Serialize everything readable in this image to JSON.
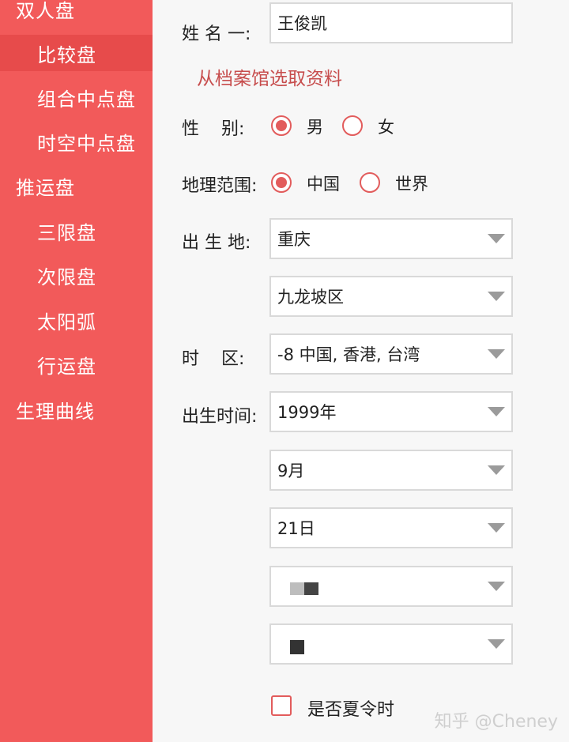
{
  "sidebar": {
    "items": [
      {
        "label": "双人盘"
      },
      {
        "label": "比较盘"
      },
      {
        "label": "组合中点盘"
      },
      {
        "label": "时空中点盘"
      },
      {
        "label": "推运盘"
      },
      {
        "label": "三限盘"
      },
      {
        "label": "次限盘"
      },
      {
        "label": "太阳弧"
      },
      {
        "label": "行运盘"
      },
      {
        "label": "生理曲线"
      }
    ]
  },
  "form": {
    "name_label": "姓 名 一:",
    "name_value": "王俊凯",
    "archive_link": "从档案馆选取资料",
    "gender_label": "性    别:",
    "gender_male": "男",
    "gender_female": "女",
    "region_label": "地理范围:",
    "region_china": "中国",
    "region_world": "世界",
    "birthplace_label": "出 生 地:",
    "province": "重庆",
    "district": "九龙坡区",
    "timezone_label": "时    区:",
    "timezone": "-8 中国, 香港, 台湾",
    "birthtime_label": "出生时间:",
    "year": "1999年",
    "month": "9月",
    "day": "21日",
    "dst_label": "是否夏令时"
  },
  "watermark": "知乎 @Cheney",
  "colors": {
    "accent": "#f25a5a",
    "radio": "#e25c5c"
  }
}
